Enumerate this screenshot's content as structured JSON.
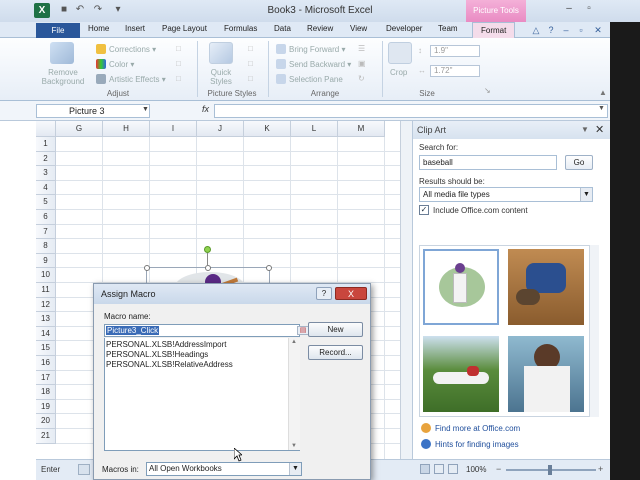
{
  "window": {
    "title": "Book3 - Microsoft Excel",
    "contextual_tab_group": "Picture Tools"
  },
  "tabs": [
    "File",
    "Home",
    "Insert",
    "Page Layout",
    "Formulas",
    "Data",
    "Review",
    "View",
    "Developer",
    "Team",
    "Format"
  ],
  "active_tab": "Format",
  "ribbon": {
    "adjust": {
      "remove_background": "Remove Background",
      "corrections": "Corrections",
      "color": "Color",
      "artistic_effects": "Artistic Effects",
      "label": "Adjust"
    },
    "picture_styles": {
      "quick_styles": "Quick Styles",
      "label": "Picture Styles"
    },
    "arrange": {
      "bring_forward": "Bring Forward",
      "send_backward": "Send Backward",
      "selection_pane": "Selection Pane",
      "label": "Arrange"
    },
    "size": {
      "crop": "Crop",
      "height": "1.9\"",
      "width": "1.72\"",
      "label": "Size"
    }
  },
  "formula_bar": {
    "name_box": "Picture 3",
    "fx": "fx"
  },
  "grid": {
    "columns": [
      "G",
      "H",
      "I",
      "J",
      "K",
      "L",
      "M"
    ],
    "rows": [
      "1",
      "2",
      "3",
      "4",
      "5",
      "6",
      "7",
      "8",
      "9",
      "10",
      "11",
      "12",
      "13",
      "14",
      "15",
      "16",
      "17",
      "18",
      "19",
      "20",
      "21"
    ]
  },
  "status": {
    "mode": "Enter",
    "zoom": "100%"
  },
  "clip_art": {
    "title": "Clip Art",
    "search_label": "Search for:",
    "search_value": "baseball",
    "go_button": "Go",
    "results_label": "Results should be:",
    "results_value": "All media file types",
    "include_office": "Include Office.com content",
    "link_find_more": "Find more at Office.com",
    "link_hints": "Hints for finding images"
  },
  "dialog": {
    "title": "Assign Macro",
    "help": "?",
    "close": "X",
    "macro_name_label": "Macro name:",
    "macro_name_value": "Picture3_Click",
    "macros": [
      "PERSONAL.XLSB!AddressImport",
      "PERSONAL.XLSB!Headings",
      "PERSONAL.XLSB!RelativeAddress"
    ],
    "new_button": "New",
    "record_button": "Record...",
    "macros_in_label": "Macros in:",
    "macros_in_value": "All Open Workbooks"
  },
  "colors": {
    "accent": "#2a579a",
    "picture_tools": "#e98bc3",
    "excel_green": "#1e7145",
    "dialog_close": "#c9463d"
  }
}
